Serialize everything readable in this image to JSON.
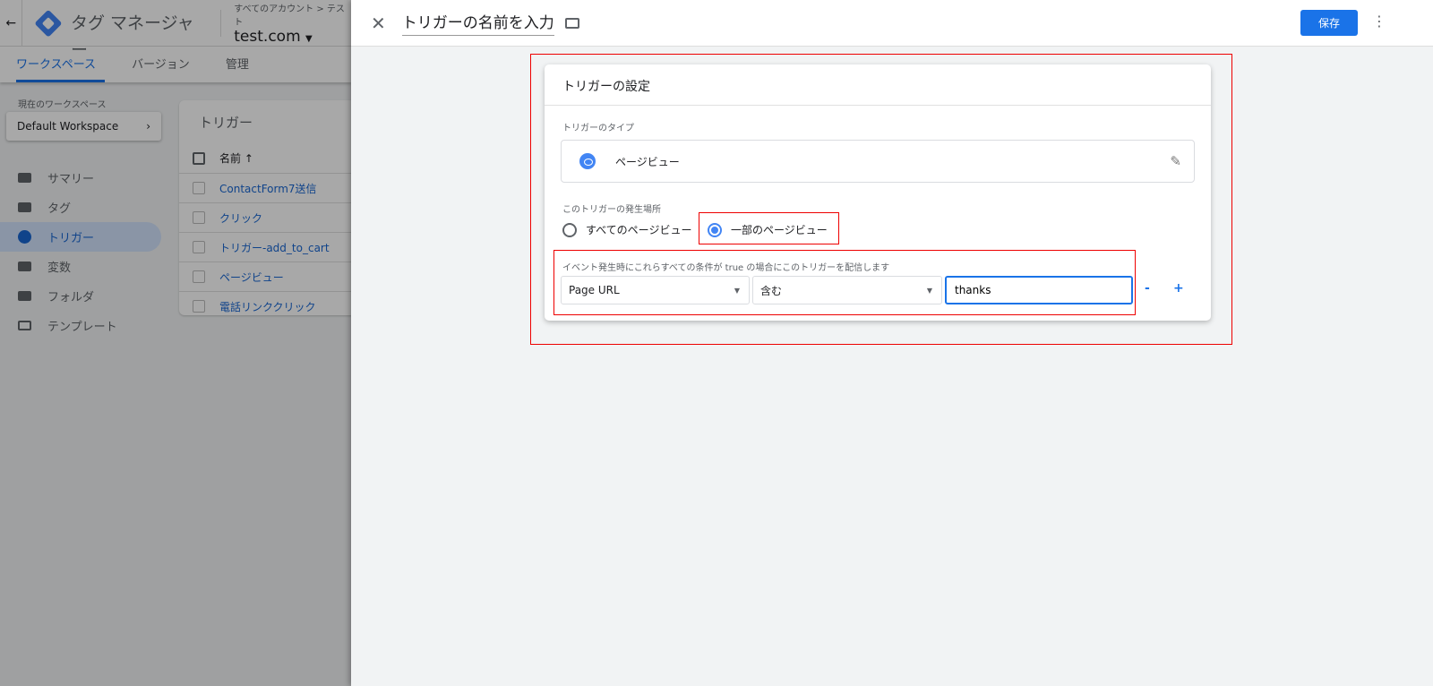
{
  "app": {
    "name": "タグ マネージャー",
    "breadcrumb": "すべてのアカウント > テスト",
    "container": "test.com"
  },
  "tabs": [
    {
      "label": "ワークスペース",
      "active": true
    },
    {
      "label": "バージョン"
    },
    {
      "label": "管理"
    }
  ],
  "workspace": {
    "label": "現在のワークスペース",
    "name": "Default Workspace"
  },
  "sidebar": {
    "items": [
      {
        "label": "サマリー"
      },
      {
        "label": "タグ"
      },
      {
        "label": "トリガー",
        "active": true
      },
      {
        "label": "変数"
      },
      {
        "label": "フォルダ"
      },
      {
        "label": "テンプレート"
      }
    ]
  },
  "list": {
    "title": "トリガー",
    "column": "名前 ↑",
    "rows": [
      "ContactForm7送信",
      "クリック",
      "トリガー-add_to_cart",
      "ページビュー",
      "電話リンククリック"
    ]
  },
  "panel": {
    "name_placeholder": "トリガーの名前を入力",
    "save_label": "保存",
    "card_title": "トリガーの設定",
    "type_label": "トリガーのタイプ",
    "type_value": "ページビュー",
    "fire_label": "このトリガーの発生場所",
    "radio_all": "すべてのページビュー",
    "radio_some": "一部のページビュー",
    "selected": "一部のページビュー",
    "condition_label": "イベント発生時にこれらすべての条件が true の場合にこのトリガーを配信します",
    "condition": {
      "variable": "Page URL",
      "operator": "含む",
      "value": "thanks"
    },
    "minus": "-",
    "plus": "+"
  },
  "colors": {
    "accent": "#1a73e8",
    "highlight": "#ee0000"
  }
}
